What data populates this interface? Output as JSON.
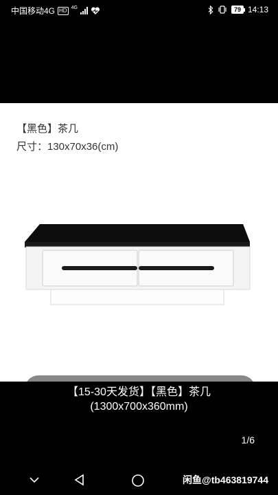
{
  "status_bar": {
    "carrier": "中国移动4G",
    "hd": "HD",
    "network": "4G",
    "battery": "79",
    "time": "14:13"
  },
  "product": {
    "title": "【黑色】茶几",
    "size_line": "尺寸：130x70x36(cm)"
  },
  "caption": {
    "line1": "【15-30天发货】【黑色】茶几",
    "line2": "(1300x700x360mm)"
  },
  "pager": "1/6",
  "watermark": "闲鱼@tb463819744",
  "colors": {
    "background": "#000000",
    "card": "#ffffff",
    "tabletop": "#1a1a1a",
    "body": "#f2f2f2"
  },
  "icons": [
    "heart-monitor-icon",
    "bluetooth-icon",
    "vibrate-icon",
    "chevron-down-icon",
    "back-triangle-icon",
    "home-circle-icon"
  ]
}
